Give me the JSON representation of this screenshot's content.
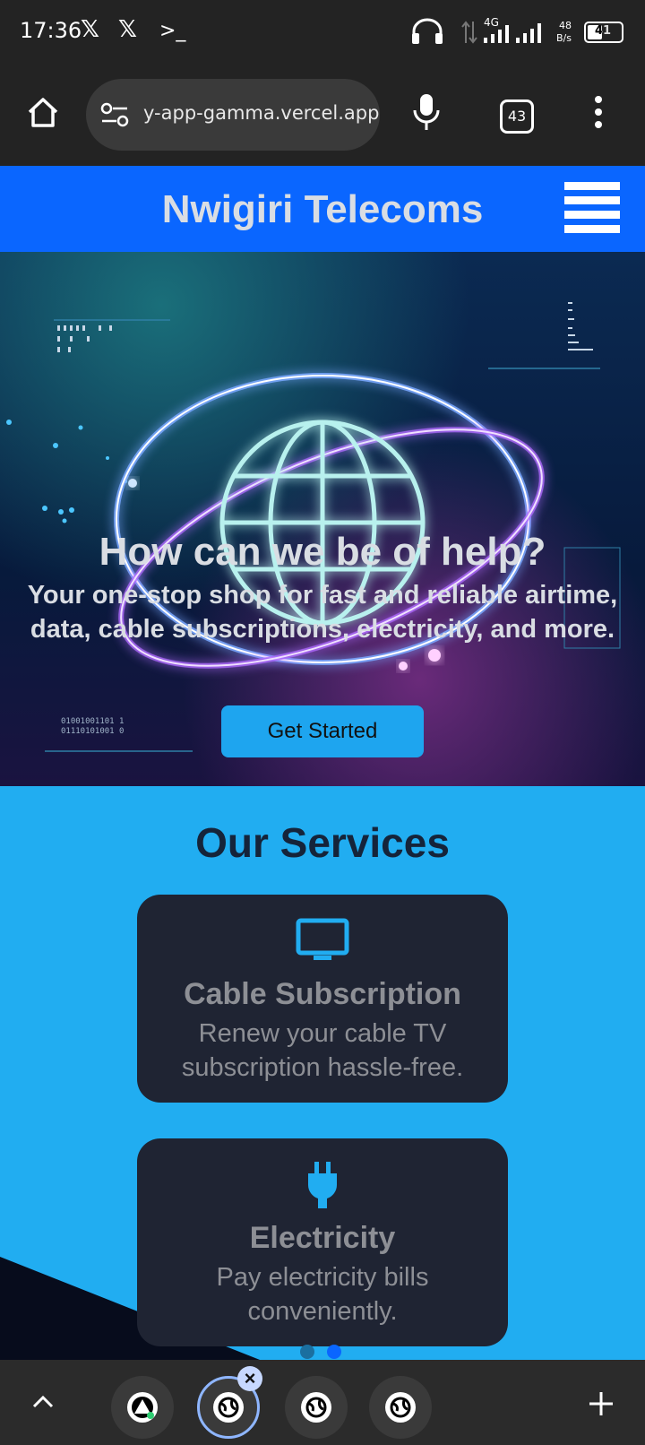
{
  "status_bar": {
    "time": "17:36",
    "network": "4G",
    "speed_value": "48",
    "speed_unit": "B/s",
    "battery": "41"
  },
  "browser": {
    "url": "y-app-gamma.vercel.app",
    "tab_count": "43"
  },
  "header": {
    "title": "Nwigiri Telecoms"
  },
  "hero": {
    "title": "How can we be of help?",
    "subtitle": "Your one-stop shop for fast and reliable airtime, data, cable subscriptions, electricity, and more.",
    "cta_label": "Get Started",
    "binary_text_line1": "01001001101 1",
    "binary_text_line2": "01110101001 0"
  },
  "services": {
    "title": "Our Services",
    "items": [
      {
        "icon": "tv-icon",
        "title": "Cable Subscription",
        "description": "Renew your cable TV subscription hassle-free."
      },
      {
        "icon": "plug-icon",
        "title": "Electricity",
        "description": "Pay electricity bills conveniently."
      }
    ]
  },
  "colors": {
    "header_blue": "#0a66ff",
    "services_bg": "#21adf1",
    "card_bg": "#1f2433",
    "cta_bg": "#1ea5ef"
  }
}
